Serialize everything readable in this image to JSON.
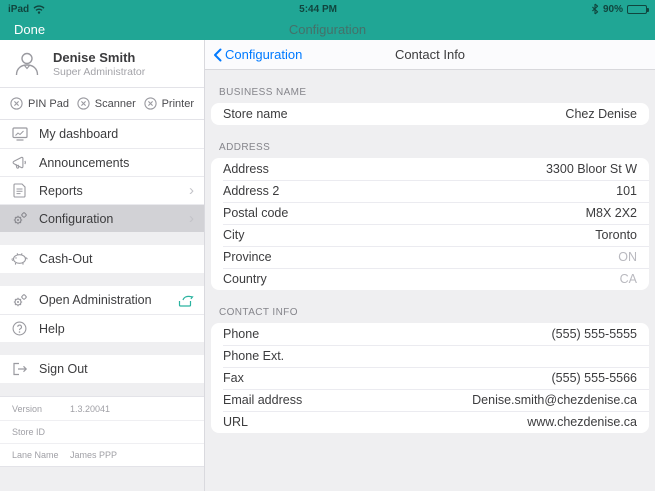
{
  "colors": {
    "teal": "#20A695",
    "ios_blue": "#007AFF",
    "selected_row": "#D2D2D6",
    "panel_bg": "#EFEFF1",
    "muted_value": "#B9B9BF",
    "icon_gray": "#9A9AA0"
  },
  "status_bar": {
    "carrier": "iPad",
    "time": "5:44 PM",
    "battery": "90%"
  },
  "nav_bar": {
    "done_label": "Done",
    "title": "Configuration"
  },
  "sidebar": {
    "profile": {
      "name": "Denise Smith",
      "role": "Super Administrator"
    },
    "devices": [
      {
        "label": "PIN Pad",
        "icon": "pinpad-disconnected-icon"
      },
      {
        "label": "Scanner",
        "icon": "scanner-disconnected-icon"
      },
      {
        "label": "Printer",
        "icon": "printer-disconnected-icon"
      }
    ],
    "menu": [
      {
        "label": "My dashboard",
        "icon": "dashboard-icon"
      },
      {
        "label": "Announcements",
        "icon": "megaphone-icon"
      },
      {
        "label": "Reports",
        "icon": "document-icon",
        "chevron": "›"
      },
      {
        "label": "Configuration",
        "icon": "gears-icon",
        "chevron": "›",
        "selected": true
      },
      {
        "label": "Cash-Out",
        "icon": "piggy-bank-icon"
      },
      {
        "label": "Open Administration",
        "icon": "gears-icon",
        "external": true
      },
      {
        "label": "Help",
        "icon": "question-circle-icon"
      },
      {
        "label": "Sign Out",
        "icon": "sign-out-icon"
      }
    ],
    "footer": [
      {
        "label": "Version",
        "value": "1.3.20041"
      },
      {
        "label": "Store ID",
        "value": ""
      },
      {
        "label": "Lane Name",
        "value": "James PPP"
      }
    ]
  },
  "content": {
    "back_label": "Configuration",
    "title": "Contact Info",
    "sections": [
      {
        "header": "BUSINESS NAME",
        "rows": [
          {
            "label": "Store name",
            "value": "Chez Denise"
          }
        ]
      },
      {
        "header": "ADDRESS",
        "rows": [
          {
            "label": "Address",
            "value": "3300 Bloor St W"
          },
          {
            "label": "Address 2",
            "value": "101"
          },
          {
            "label": "Postal code",
            "value": "M8X 2X2"
          },
          {
            "label": "City",
            "value": "Toronto"
          },
          {
            "label": "Province",
            "value": "ON",
            "muted": true
          },
          {
            "label": "Country",
            "value": "CA",
            "muted": true
          }
        ]
      },
      {
        "header": "CONTACT INFO",
        "rows": [
          {
            "label": "Phone",
            "value": "(555) 555-5555"
          },
          {
            "label": "Phone Ext.",
            "value": ""
          },
          {
            "label": "Fax",
            "value": "(555) 555-5566"
          },
          {
            "label": "Email address",
            "value": "Denise.smith@chezdenise.ca"
          },
          {
            "label": "URL",
            "value": "www.chezdenise.ca"
          }
        ]
      }
    ]
  }
}
